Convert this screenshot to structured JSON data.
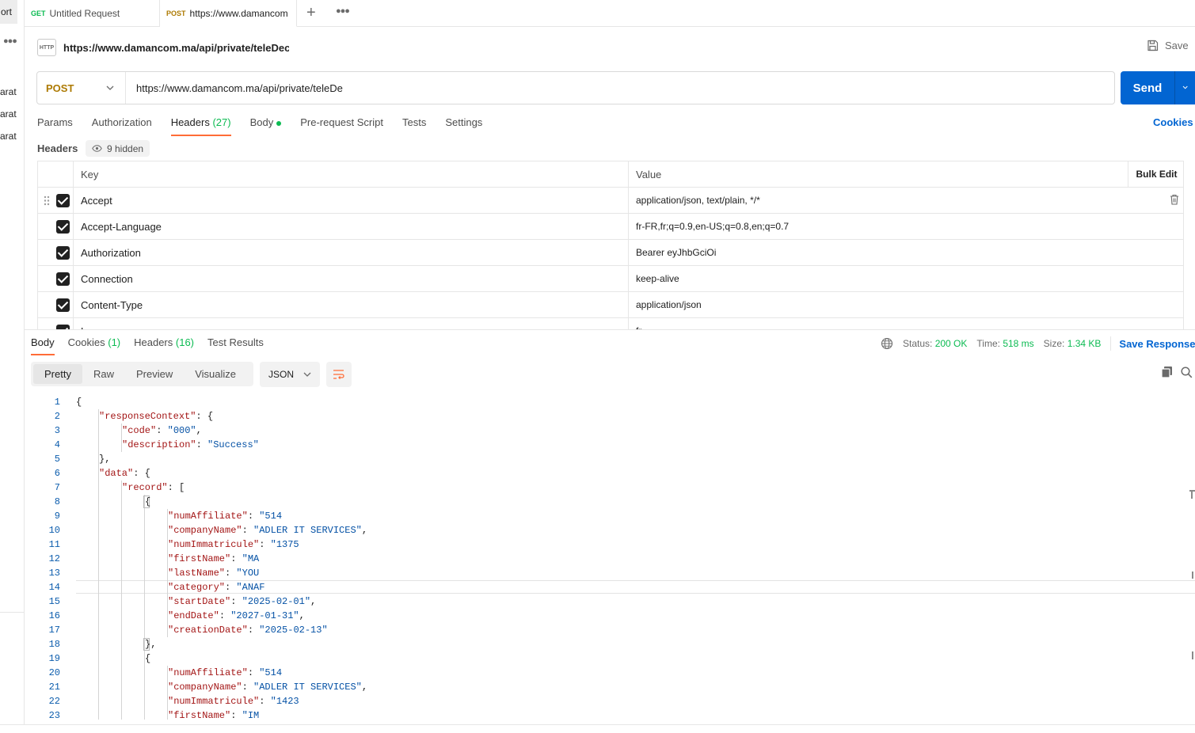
{
  "sidebar": {
    "import_label": "ort",
    "items": [
      "arat",
      "arat",
      "arat"
    ]
  },
  "tabs": [
    {
      "method": "GET",
      "title": "Untitled Request"
    },
    {
      "method": "POST",
      "title": "https://www.damancom"
    }
  ],
  "request": {
    "title": "https://www.damancom.ma/api/private/teleDecla",
    "save_label": "Save",
    "method": "POST",
    "url": "https://www.damancom.ma/api/private/teleDe",
    "send_label": "Send",
    "tabs": [
      {
        "label": "Params",
        "count": ""
      },
      {
        "label": "Authorization",
        "count": ""
      },
      {
        "label": "Headers",
        "count": "(27)"
      },
      {
        "label": "Body",
        "count": ""
      },
      {
        "label": "Pre-request Script",
        "count": ""
      },
      {
        "label": "Tests",
        "count": ""
      },
      {
        "label": "Settings",
        "count": ""
      }
    ],
    "cookies_label": "Cookies",
    "headers_label": "Headers",
    "hidden_badge": "9 hidden",
    "table": {
      "col_key": "Key",
      "col_value": "Value",
      "bulk_edit": "Bulk Edit",
      "rows": [
        {
          "key": "Accept",
          "value": "application/json, text/plain, */*"
        },
        {
          "key": "Accept-Language",
          "value": "fr-FR,fr;q=0.9,en-US;q=0.8,en;q=0.7"
        },
        {
          "key": "Authorization",
          "value": "Bearer eyJhbGciOi"
        },
        {
          "key": "Connection",
          "value": "keep-alive"
        },
        {
          "key": "Content-Type",
          "value": "application/json"
        },
        {
          "key": "Language",
          "value": "fr"
        }
      ]
    }
  },
  "response": {
    "tabs": [
      {
        "label": "Body",
        "count": ""
      },
      {
        "label": "Cookies",
        "count": "(1)"
      },
      {
        "label": "Headers",
        "count": "(16)"
      },
      {
        "label": "Test Results",
        "count": ""
      }
    ],
    "status_label": "Status:",
    "status_value": "200 OK",
    "time_label": "Time:",
    "time_value": "518 ms",
    "size_label": "Size:",
    "size_value": "1.34 KB",
    "save_response": "Save Response",
    "view_tabs": [
      "Pretty",
      "Raw",
      "Preview",
      "Visualize"
    ],
    "format": "JSON",
    "lines": [
      {
        "n": "1",
        "indent": 0,
        "parts": [
          [
            "p",
            "{"
          ]
        ]
      },
      {
        "n": "2",
        "indent": 1,
        "parts": [
          [
            "k",
            "\"responseContext\""
          ],
          [
            "p",
            ": {"
          ]
        ]
      },
      {
        "n": "3",
        "indent": 2,
        "parts": [
          [
            "k",
            "\"code\""
          ],
          [
            "p",
            ": "
          ],
          [
            "s",
            "\"000\""
          ],
          [
            "p",
            ","
          ]
        ]
      },
      {
        "n": "4",
        "indent": 2,
        "parts": [
          [
            "k",
            "\"description\""
          ],
          [
            "p",
            ": "
          ],
          [
            "s",
            "\"Success\""
          ]
        ]
      },
      {
        "n": "5",
        "indent": 1,
        "parts": [
          [
            "p",
            "},"
          ]
        ]
      },
      {
        "n": "6",
        "indent": 1,
        "parts": [
          [
            "k",
            "\"data\""
          ],
          [
            "p",
            ": {"
          ]
        ]
      },
      {
        "n": "7",
        "indent": 2,
        "parts": [
          [
            "k",
            "\"record\""
          ],
          [
            "p",
            ": ["
          ]
        ]
      },
      {
        "n": "8",
        "indent": 3,
        "parts": [
          [
            "p",
            "{"
          ]
        ]
      },
      {
        "n": "9",
        "indent": 4,
        "parts": [
          [
            "k",
            "\"numAffiliate\""
          ],
          [
            "p",
            ": "
          ],
          [
            "s",
            "\"514"
          ]
        ]
      },
      {
        "n": "10",
        "indent": 4,
        "parts": [
          [
            "k",
            "\"companyName\""
          ],
          [
            "p",
            ": "
          ],
          [
            "s",
            "\"ADLER IT SERVICES\""
          ],
          [
            "p",
            ","
          ]
        ]
      },
      {
        "n": "11",
        "indent": 4,
        "parts": [
          [
            "k",
            "\"numImmatricule\""
          ],
          [
            "p",
            ": "
          ],
          [
            "s",
            "\"1375"
          ]
        ]
      },
      {
        "n": "12",
        "indent": 4,
        "parts": [
          [
            "k",
            "\"firstName\""
          ],
          [
            "p",
            ": "
          ],
          [
            "s",
            "\"MA"
          ]
        ]
      },
      {
        "n": "13",
        "indent": 4,
        "parts": [
          [
            "k",
            "\"lastName\""
          ],
          [
            "p",
            ": "
          ],
          [
            "s",
            "\"YOU"
          ]
        ]
      },
      {
        "n": "14",
        "indent": 4,
        "parts": [
          [
            "k",
            "\"category\""
          ],
          [
            "p",
            ": "
          ],
          [
            "s",
            "\"ANAF"
          ]
        ]
      },
      {
        "n": "15",
        "indent": 4,
        "parts": [
          [
            "k",
            "\"startDate\""
          ],
          [
            "p",
            ": "
          ],
          [
            "s",
            "\"2025-02-01\""
          ],
          [
            "p",
            ","
          ]
        ]
      },
      {
        "n": "16",
        "indent": 4,
        "parts": [
          [
            "k",
            "\"endDate\""
          ],
          [
            "p",
            ": "
          ],
          [
            "s",
            "\"2027-01-31\""
          ],
          [
            "p",
            ","
          ]
        ]
      },
      {
        "n": "17",
        "indent": 4,
        "parts": [
          [
            "k",
            "\"creationDate\""
          ],
          [
            "p",
            ": "
          ],
          [
            "s",
            "\"2025-02-13\""
          ]
        ]
      },
      {
        "n": "18",
        "indent": 3,
        "parts": [
          [
            "p",
            "},"
          ]
        ]
      },
      {
        "n": "19",
        "indent": 3,
        "parts": [
          [
            "p",
            "{"
          ]
        ]
      },
      {
        "n": "20",
        "indent": 4,
        "parts": [
          [
            "k",
            "\"numAffiliate\""
          ],
          [
            "p",
            ": "
          ],
          [
            "s",
            "\"514"
          ]
        ]
      },
      {
        "n": "21",
        "indent": 4,
        "parts": [
          [
            "k",
            "\"companyName\""
          ],
          [
            "p",
            ": "
          ],
          [
            "s",
            "\"ADLER IT SERVICES\""
          ],
          [
            "p",
            ","
          ]
        ]
      },
      {
        "n": "22",
        "indent": 4,
        "parts": [
          [
            "k",
            "\"numImmatricule\""
          ],
          [
            "p",
            ": "
          ],
          [
            "s",
            "\"1423"
          ]
        ]
      },
      {
        "n": "23",
        "indent": 4,
        "parts": [
          [
            "k",
            "\"firstName\""
          ],
          [
            "p",
            ": "
          ],
          [
            "s",
            "\"IM"
          ]
        ]
      }
    ]
  },
  "colors": {
    "accent": "#ff6c37",
    "send": "#0265d2",
    "post": "#ad7a03",
    "get": "#0cbb52",
    "json_key": "#a31515",
    "json_string": "#0451a5"
  }
}
